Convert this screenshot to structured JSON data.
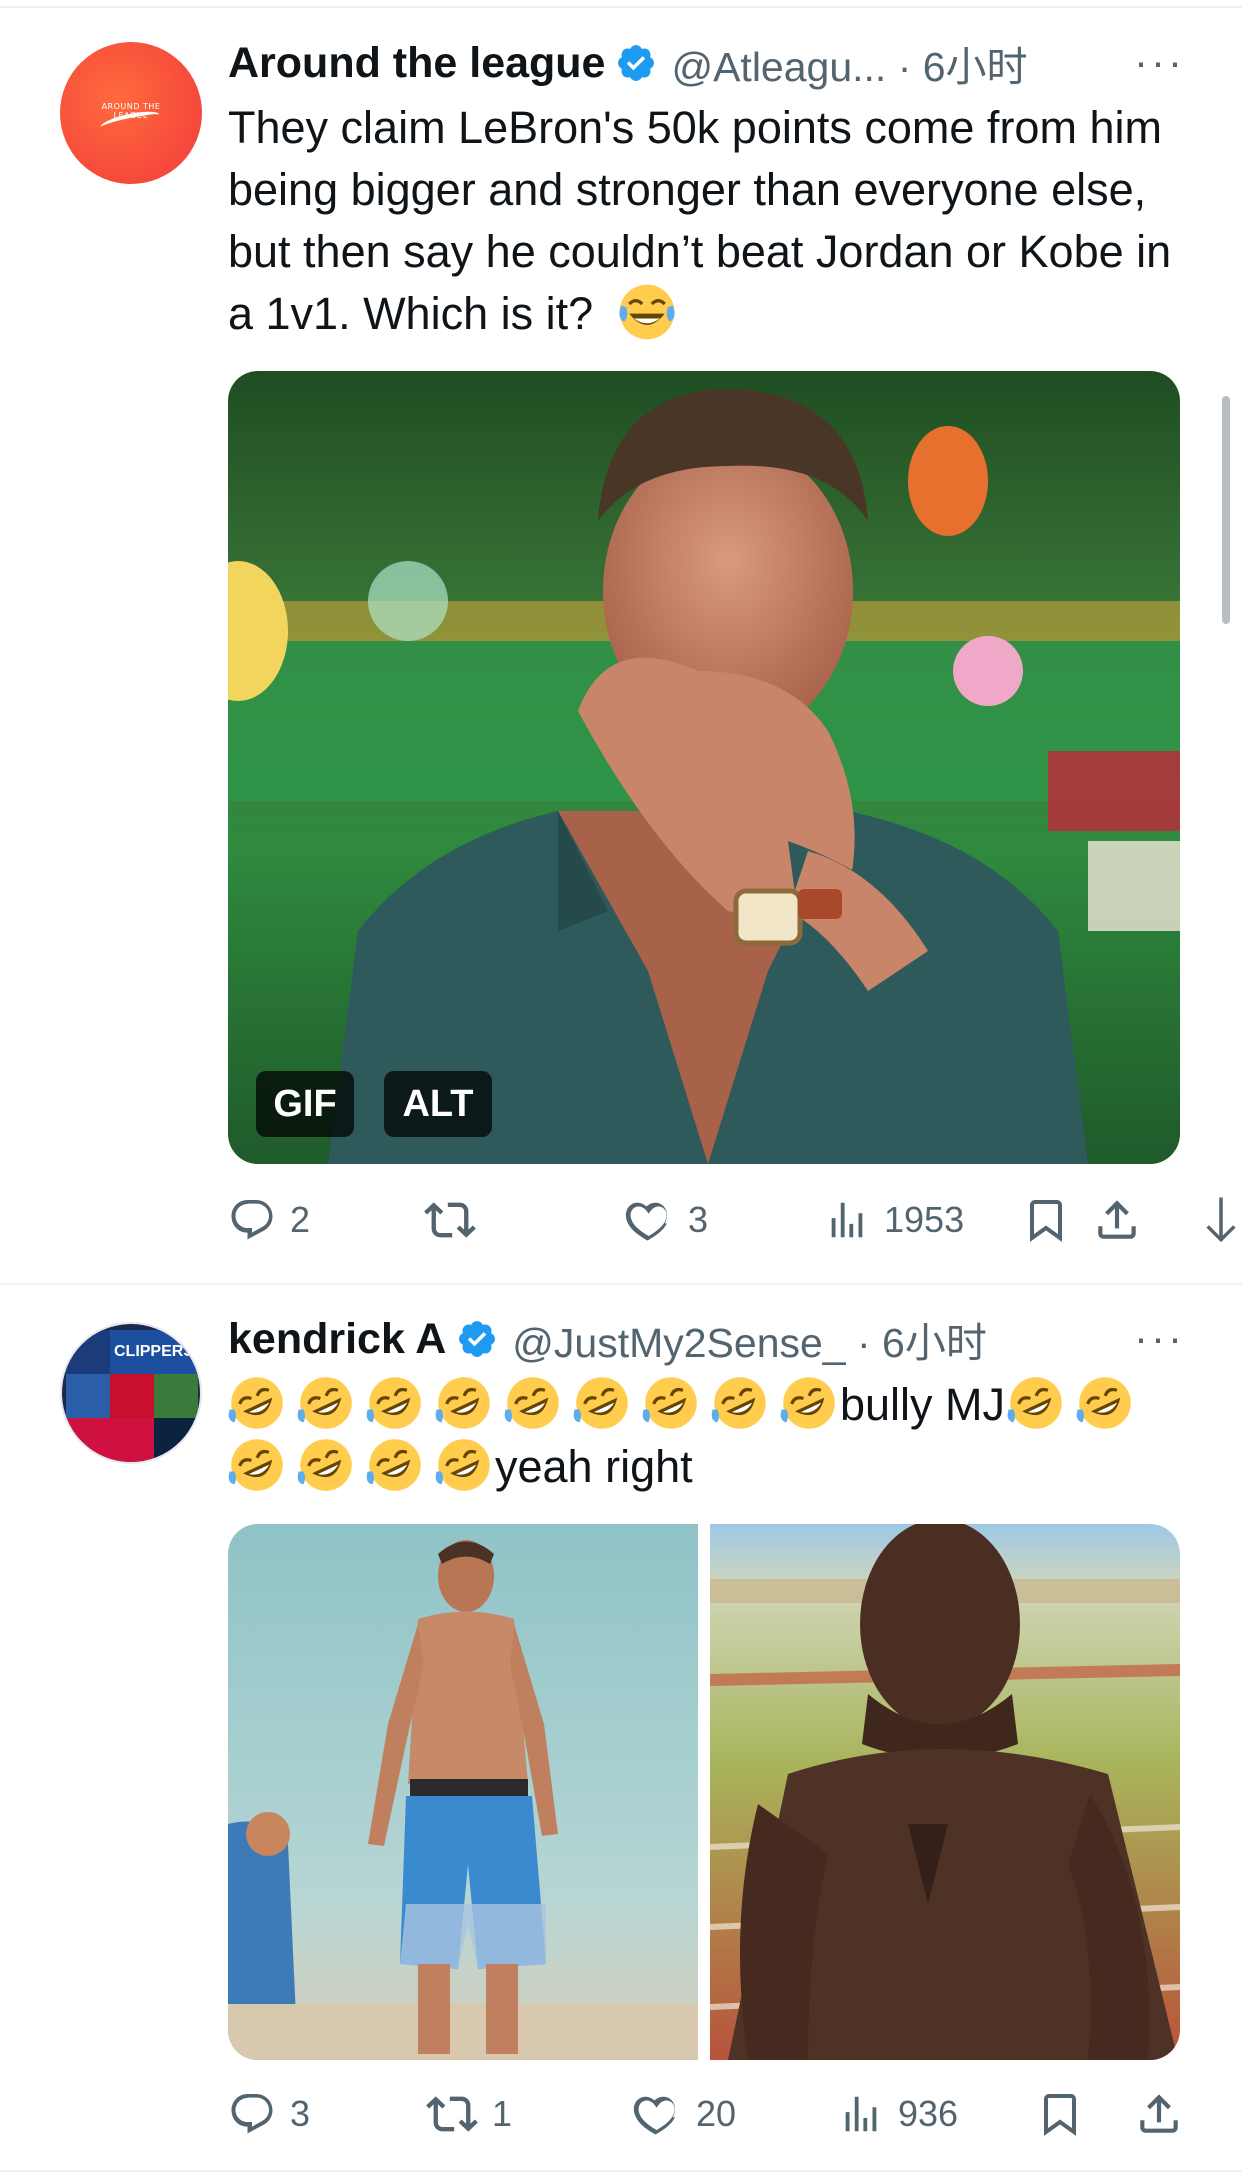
{
  "tweets": [
    {
      "display_name": "Around the league",
      "handle_time": "@Atleagu... · 6小时",
      "text": "They claim LeBron's 50k points come from him being bigger and stronger than everyone else, but then say he couldn’t beat Jordan or Kobe in a 1v1. Which is it?",
      "avatar_logo_text": "AROUND THE LEAGUE",
      "media_badges": [
        "GIF",
        "ALT"
      ],
      "actions": {
        "replies": "2",
        "retweets": "",
        "likes": "3",
        "views": "1953"
      }
    },
    {
      "display_name": "kendrick A",
      "handle_time": "@JustMy2Sense_ · 6小时",
      "text_line1": "bully MJ",
      "text_line2": "yeah right",
      "avatar_logo_text": "CLIPPERS",
      "actions": {
        "replies": "3",
        "retweets": "1",
        "likes": "20",
        "views": "936"
      }
    }
  ],
  "more_label": "···",
  "icons": [
    "verified-badge-icon",
    "reply-icon",
    "retweet-icon",
    "like-icon",
    "views-icon",
    "bookmark-icon",
    "share-icon",
    "more-icon",
    "laughing-tears-emoji",
    "rofl-emoji"
  ],
  "colors": {
    "verified": "#1d9bf0",
    "muted": "#536471",
    "text": "#0f1419",
    "divider": "#eff3f4"
  }
}
